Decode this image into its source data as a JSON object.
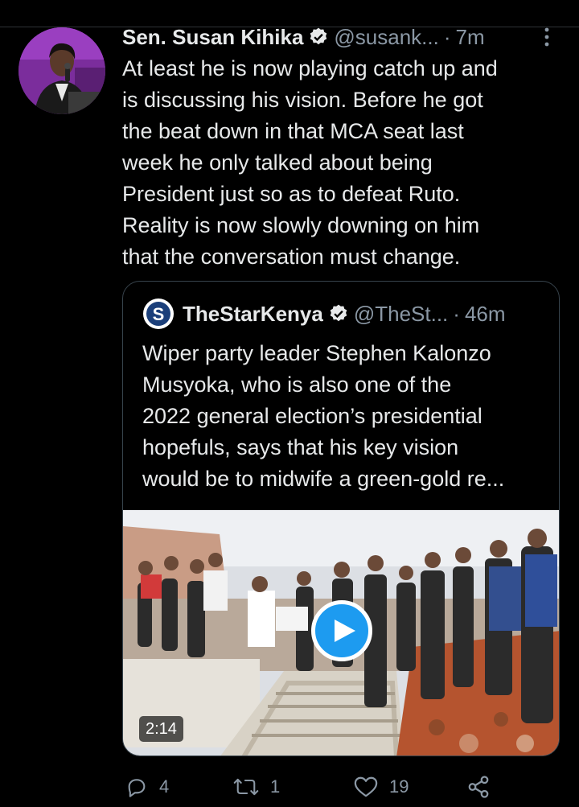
{
  "tweet": {
    "author_name": "Sen. Susan Kihika",
    "handle": "@susank...",
    "separator": "·",
    "time": "7m",
    "lines": [
      "At least he is now playing catch up and",
      "is discussing his vision. Before he got",
      "the beat down in that MCA seat last",
      "week he only talked about being",
      "President just so as to defeat Ruto.",
      "Reality is now slowly downing on him",
      "that the conversation must change."
    ]
  },
  "quote": {
    "author_name": "TheStarKenya",
    "handle": "@TheSt...",
    "separator": "·",
    "time": "46m",
    "logo_letter": "S",
    "lines": [
      "Wiper party leader Stephen Kalonzo",
      "Musyoka, who is also one of the",
      "2022 general election’s presidential",
      "hopefuls, says that his key vision",
      "would be to midwife a green-gold re..."
    ],
    "video": {
      "duration": "2:14"
    }
  },
  "actions": {
    "replies": "4",
    "retweets": "1",
    "likes": "19"
  },
  "icons": [
    "more-vertical-icon",
    "verified-badge-icon",
    "play-icon",
    "reply-icon",
    "retweet-icon",
    "like-icon",
    "share-icon"
  ],
  "colors": {
    "background": "#000000",
    "text": "#e7e9ea",
    "secondary": "#8b98a5",
    "accent": "#1d9bf0",
    "border": "#38444d"
  }
}
